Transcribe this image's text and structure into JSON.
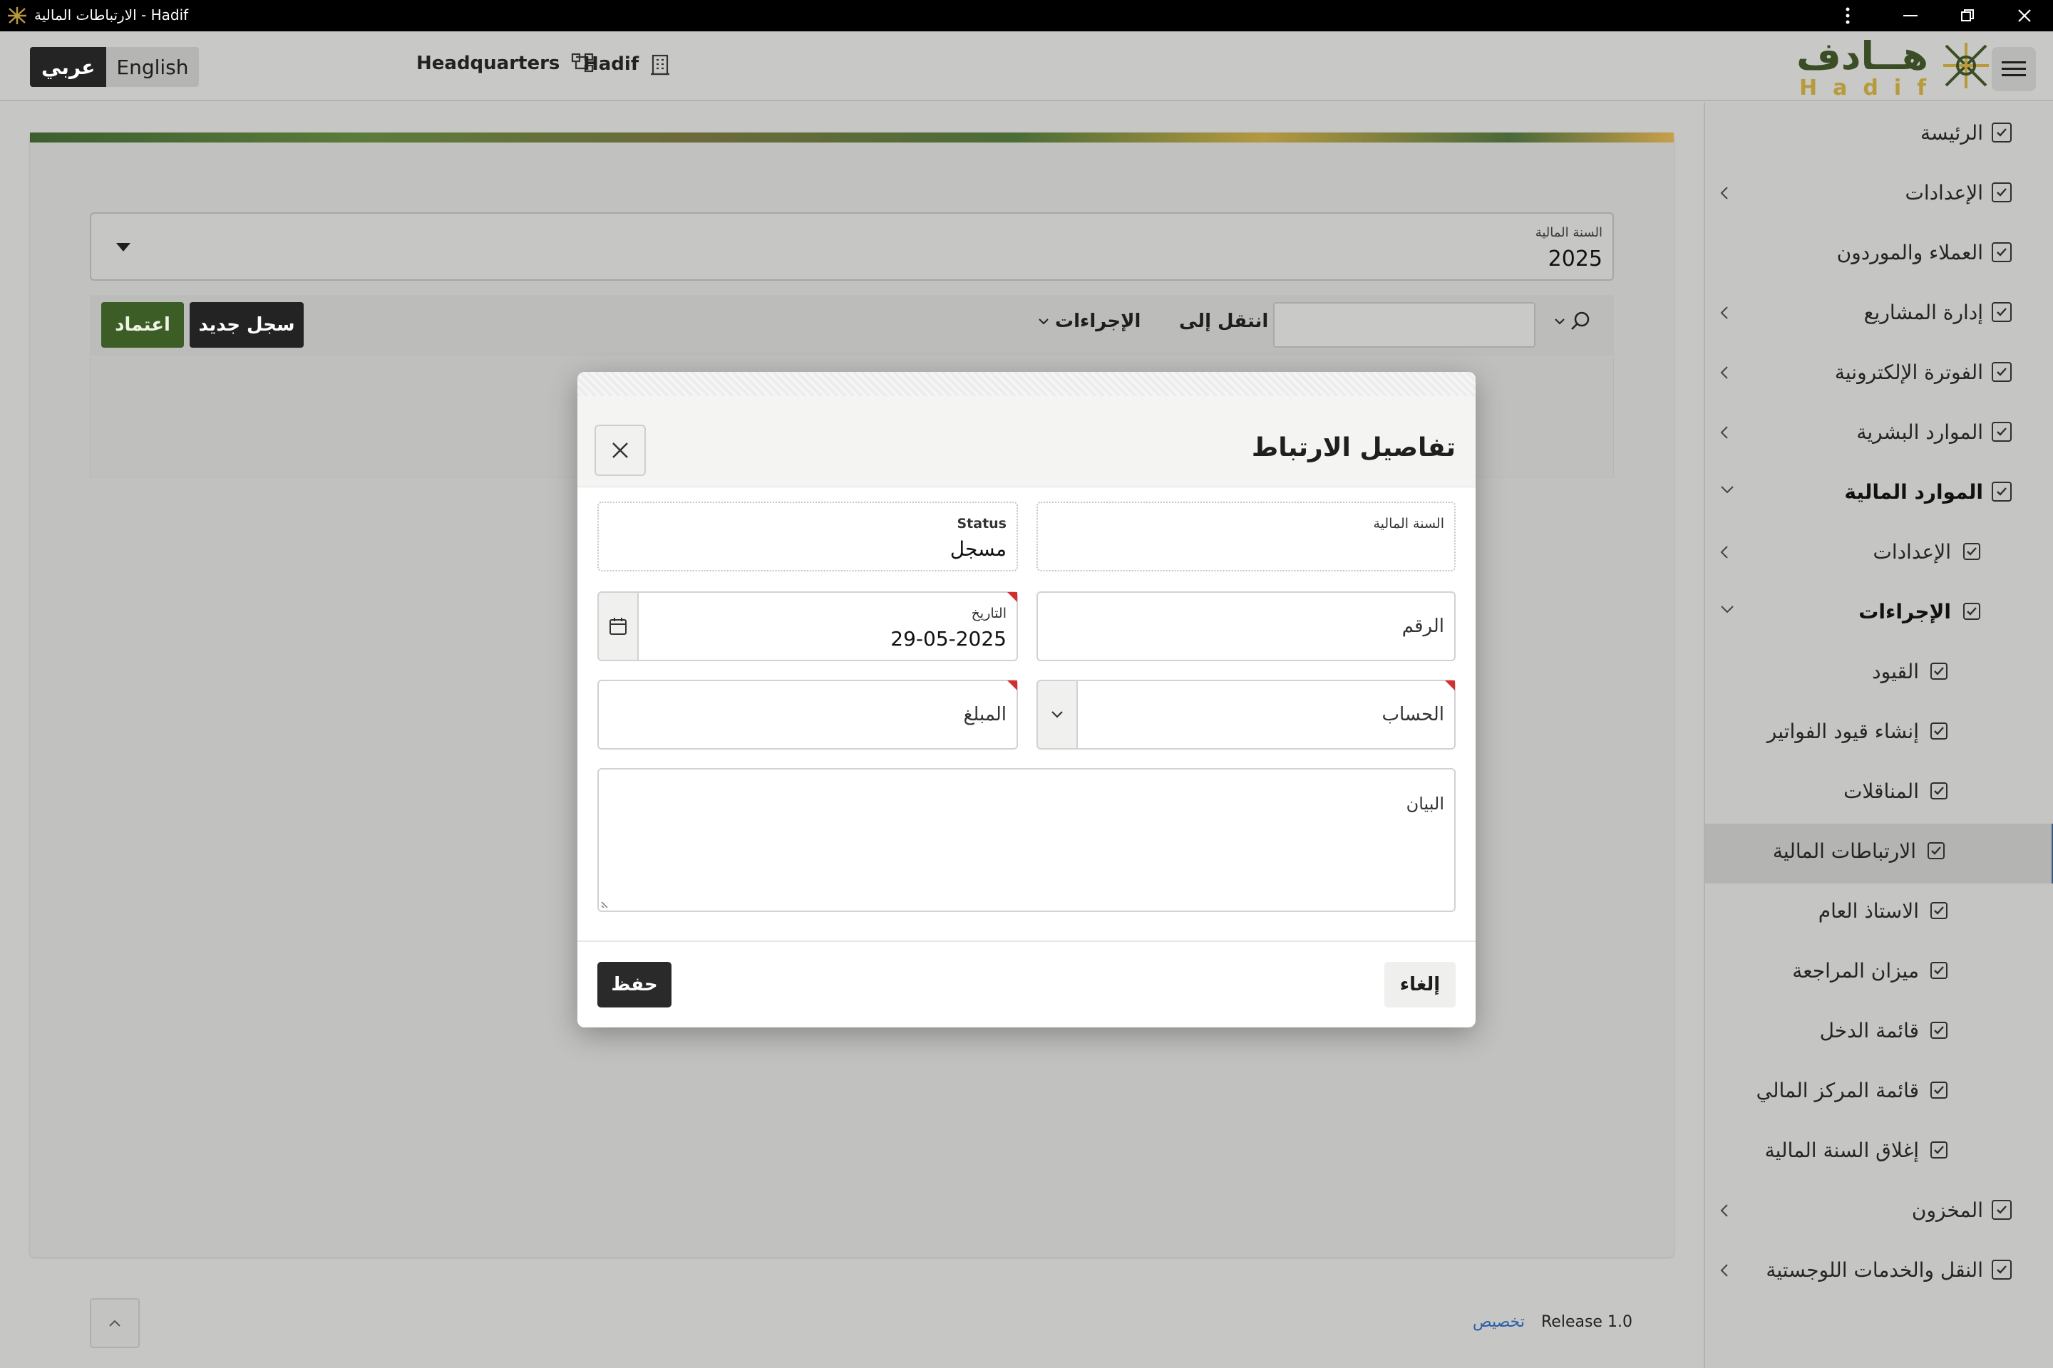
{
  "window": {
    "title": "الارتباطات المالية - Hadif"
  },
  "header": {
    "lang_ar": "عربي",
    "lang_en": "English",
    "headquarters": "Headquarters",
    "company": "Hadif",
    "logo_ar": "هــادف",
    "logo_en": "Hadif"
  },
  "sidebar": {
    "items": [
      {
        "label": "الرئيسة",
        "chevron": false,
        "level": 0
      },
      {
        "label": "الإعدادات",
        "chevron": "right",
        "level": 0
      },
      {
        "label": "العملاء والموردون",
        "chevron": false,
        "level": 0
      },
      {
        "label": "إدارة المشاريع",
        "chevron": "right",
        "level": 0
      },
      {
        "label": "الفوترة الإلكترونية",
        "chevron": "right",
        "level": 0
      },
      {
        "label": "الموارد البشرية",
        "chevron": "right",
        "level": 0
      },
      {
        "label": "الموارد المالية",
        "chevron": "down",
        "level": 0,
        "bold": true
      },
      {
        "label": "الإعدادات",
        "chevron": "right",
        "level": 1
      },
      {
        "label": "الإجراءات",
        "chevron": "down",
        "level": 1,
        "bold": true
      },
      {
        "label": "القيود",
        "chevron": false,
        "level": 2
      },
      {
        "label": "إنشاء قيود الفواتير",
        "chevron": false,
        "level": 2
      },
      {
        "label": "المناقلات",
        "chevron": false,
        "level": 2
      },
      {
        "label": "الارتباطات المالية",
        "chevron": false,
        "level": 2,
        "selected": true
      },
      {
        "label": "الاستاذ العام",
        "chevron": false,
        "level": 2
      },
      {
        "label": "ميزان المراجعة",
        "chevron": false,
        "level": 2
      },
      {
        "label": "قائمة الدخل",
        "chevron": false,
        "level": 2
      },
      {
        "label": "قائمة المركز المالي",
        "chevron": false,
        "level": 2
      },
      {
        "label": "إغلاق السنة المالية",
        "chevron": false,
        "level": 2
      },
      {
        "label": "المخزون",
        "chevron": "right",
        "level": 0
      },
      {
        "label": "النقل والخدمات اللوجستية",
        "chevron": "right",
        "level": 0
      }
    ]
  },
  "main": {
    "fiscal_year_label": "السنة المالية",
    "fiscal_year_value": "2025",
    "approve_button": "اعتماد",
    "new_record_button": "سجل جديد",
    "actions_menu": "الإجراءات",
    "goto_label": "انتقل إلى",
    "search_value": ""
  },
  "footer": {
    "release": "Release 1.0",
    "customize": "تخصيص"
  },
  "modal": {
    "title": "تفاصيل الارتباط",
    "fields": {
      "fiscal_year_label": "السنة المالية",
      "fiscal_year_value": "",
      "status_label": "Status",
      "status_value": "مسجل",
      "number_placeholder": "الرقم",
      "date_label": "التاريخ",
      "date_value": "29-05-2025",
      "account_placeholder": "الحساب",
      "amount_placeholder": "المبلغ",
      "description_placeholder": "البيان"
    },
    "save_button": "حفظ",
    "cancel_button": "إلغاء"
  },
  "colors": {
    "accent_green": "#3c5d25",
    "dark_button": "#232323",
    "required_marker": "#d32f2f",
    "link": "#2b5da8"
  }
}
